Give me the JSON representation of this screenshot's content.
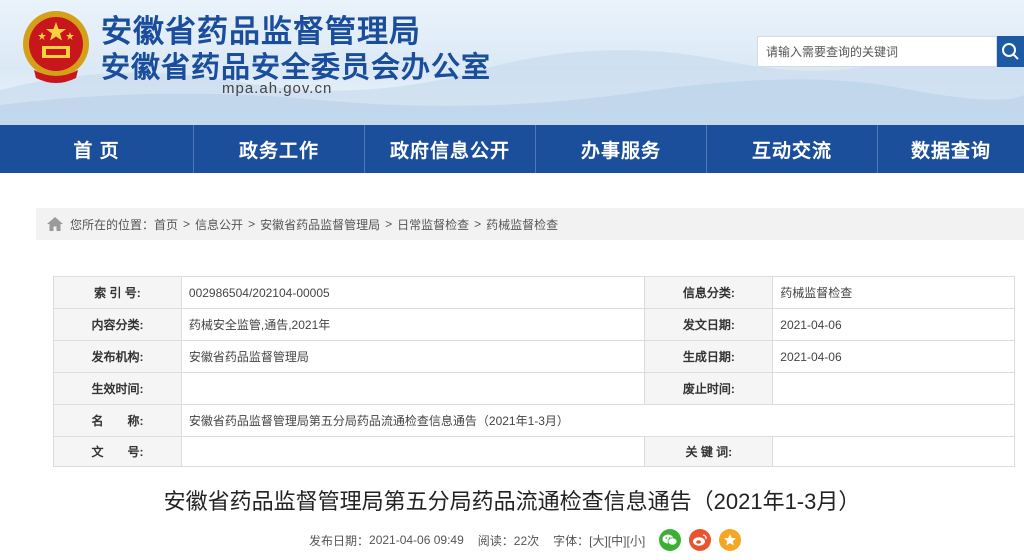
{
  "header": {
    "title_line1": "安徽省药品监督管理局",
    "title_line2": "安徽省药品安全委员会办公室",
    "domain": "mpa.ah.gov.cn",
    "search_placeholder": "请输入需要查询的关键词"
  },
  "nav": {
    "items": [
      {
        "label": "首 页"
      },
      {
        "label": "政务工作"
      },
      {
        "label": "政府信息公开"
      },
      {
        "label": "办事服务"
      },
      {
        "label": "互动交流"
      },
      {
        "label": "数据查询"
      }
    ]
  },
  "breadcrumb": {
    "prefix": "您所在的位置：",
    "items": [
      "首页",
      "信息公开",
      "安徽省药品监督管理局",
      "日常监督检查",
      "药械监督检查"
    ],
    "separator": ">"
  },
  "meta": {
    "index_label": "索 引 号:",
    "index_value": "002986504/202104-00005",
    "category_label": "信息分类:",
    "category_value": "药械监督检查",
    "content_label": "内容分类:",
    "content_value": "药械安全监管,通告,2021年",
    "issued_label": "发文日期:",
    "issued_value": "2021-04-06",
    "publisher_label": "发布机构:",
    "publisher_value": "安徽省药品监督管理局",
    "generated_label": "生成日期:",
    "generated_value": "2021-04-06",
    "effective_label": "生效时间:",
    "effective_value": "",
    "repeal_label": "废止时间:",
    "repeal_value": "",
    "name_label": "名　　称:",
    "name_value": "安徽省药品监督管理局第五分局药品流通检查信息通告（2021年1-3月）",
    "docno_label": "文　　号:",
    "docno_value": "",
    "keywords_label": "关 键 词:",
    "keywords_value": ""
  },
  "article": {
    "title": "安徽省药品监督管理局第五分局药品流通检查信息通告（2021年1-3月）",
    "date_label": "发布日期：",
    "date_value": "2021-04-06 09:49",
    "views_label": "阅读：",
    "views_value": "22次",
    "font_label": "字体：",
    "font_large": "[大]",
    "font_medium": "[中]",
    "font_small": "[小]"
  },
  "colors": {
    "brand_blue": "#1c4f9b",
    "wechat_green": "#3cb034",
    "weibo_orange": "#e8542f",
    "favorite_orange": "#f5a623"
  },
  "icons": {
    "emblem": "national-emblem-icon",
    "search": "search-icon",
    "home": "home-icon",
    "wechat": "wechat-icon",
    "weibo": "weibo-icon",
    "favorite": "star-icon"
  }
}
